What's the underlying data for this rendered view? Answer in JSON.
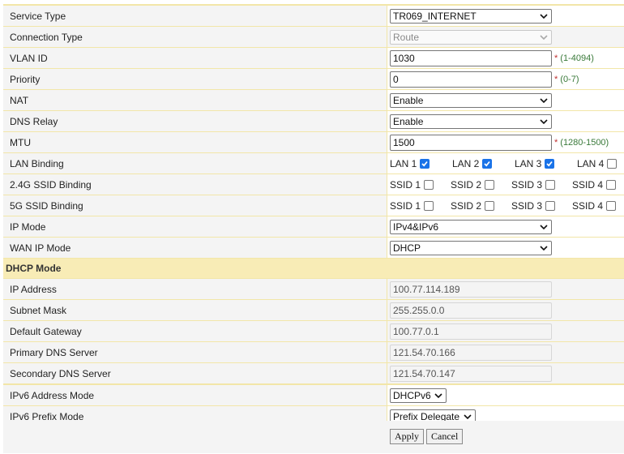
{
  "fields": {
    "service_type": {
      "label": "Service Type",
      "value": "TR069_INTERNET"
    },
    "connection_type": {
      "label": "Connection Type",
      "value": "Route"
    },
    "vlan_id": {
      "label": "VLAN ID",
      "value": "1030",
      "hint": "(1-4094)"
    },
    "priority": {
      "label": "Priority",
      "value": "0",
      "hint": "(0-7)"
    },
    "nat": {
      "label": "NAT",
      "value": "Enable"
    },
    "dns_relay": {
      "label": "DNS Relay",
      "value": "Enable"
    },
    "mtu": {
      "label": "MTU",
      "value": "1500",
      "hint": "(1280-1500)"
    },
    "lan_binding": {
      "label": "LAN Binding",
      "items": [
        {
          "label": "LAN 1",
          "checked": true
        },
        {
          "label": "LAN 2",
          "checked": true
        },
        {
          "label": "LAN 3",
          "checked": true
        },
        {
          "label": "LAN 4",
          "checked": false
        }
      ]
    },
    "ssid24_binding": {
      "label": "2.4G SSID Binding",
      "items": [
        {
          "label": "SSID 1",
          "checked": false
        },
        {
          "label": "SSID 2",
          "checked": false
        },
        {
          "label": "SSID 3",
          "checked": false
        },
        {
          "label": "SSID 4",
          "checked": false
        }
      ]
    },
    "ssid5_binding": {
      "label": "5G SSID Binding",
      "items": [
        {
          "label": "SSID 1",
          "checked": false
        },
        {
          "label": "SSID 2",
          "checked": false
        },
        {
          "label": "SSID 3",
          "checked": false
        },
        {
          "label": "SSID 4",
          "checked": false
        }
      ]
    },
    "ip_mode": {
      "label": "IP Mode",
      "value": "IPv4&IPv6"
    },
    "wan_ip_mode": {
      "label": "WAN IP Mode",
      "value": "DHCP"
    }
  },
  "dhcp": {
    "section_title": "DHCP Mode",
    "ip_address": {
      "label": "IP Address",
      "value": "100.77.114.189"
    },
    "subnet_mask": {
      "label": "Subnet Mask",
      "value": "255.255.0.0"
    },
    "default_gateway": {
      "label": "Default Gateway",
      "value": "100.77.0.1"
    },
    "primary_dns": {
      "label": "Primary DNS Server",
      "value": "121.54.70.166"
    },
    "secondary_dns": {
      "label": "Secondary DNS Server",
      "value": "121.54.70.147"
    }
  },
  "ipv6": {
    "address_mode": {
      "label": "IPv6 Address Mode",
      "value": "DHCPv6"
    },
    "prefix_mode": {
      "label": "IPv6 Prefix Mode",
      "value": "Prefix Delegate"
    }
  },
  "required_marker": "*",
  "buttons": {
    "apply": "Apply",
    "cancel": "Cancel"
  },
  "colors": {
    "checked": "#1a73e8",
    "section_bg": "#f8ecb6",
    "hint": "#3a7a3a"
  }
}
